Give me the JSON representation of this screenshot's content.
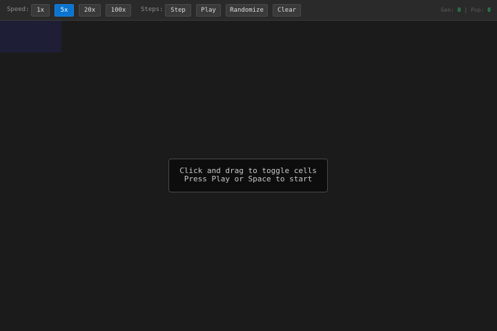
{
  "toolbar": {
    "speed_label": "Speed:",
    "speed_options": [
      "1x",
      "5x",
      "20x",
      "100x"
    ],
    "speed_selected": "5x",
    "steps_label": "Steps:",
    "step_button": "Step",
    "play_button": "Play",
    "randomize_button": "Randomize",
    "clear_button": "Clear",
    "stats": {
      "gen_label": "Gen:",
      "gen_value": "0",
      "separator": "|",
      "pop_label": "Pop:",
      "pop_value": "0"
    }
  },
  "hint": {
    "line1": "Click and drag to toggle cells",
    "line2": "Press Play or Space to start"
  },
  "colors": {
    "accent": "#0a74d0",
    "stat_value": "#1fcf7a",
    "background": "#1b1b1b",
    "toolbar": "#2a2a2a"
  }
}
